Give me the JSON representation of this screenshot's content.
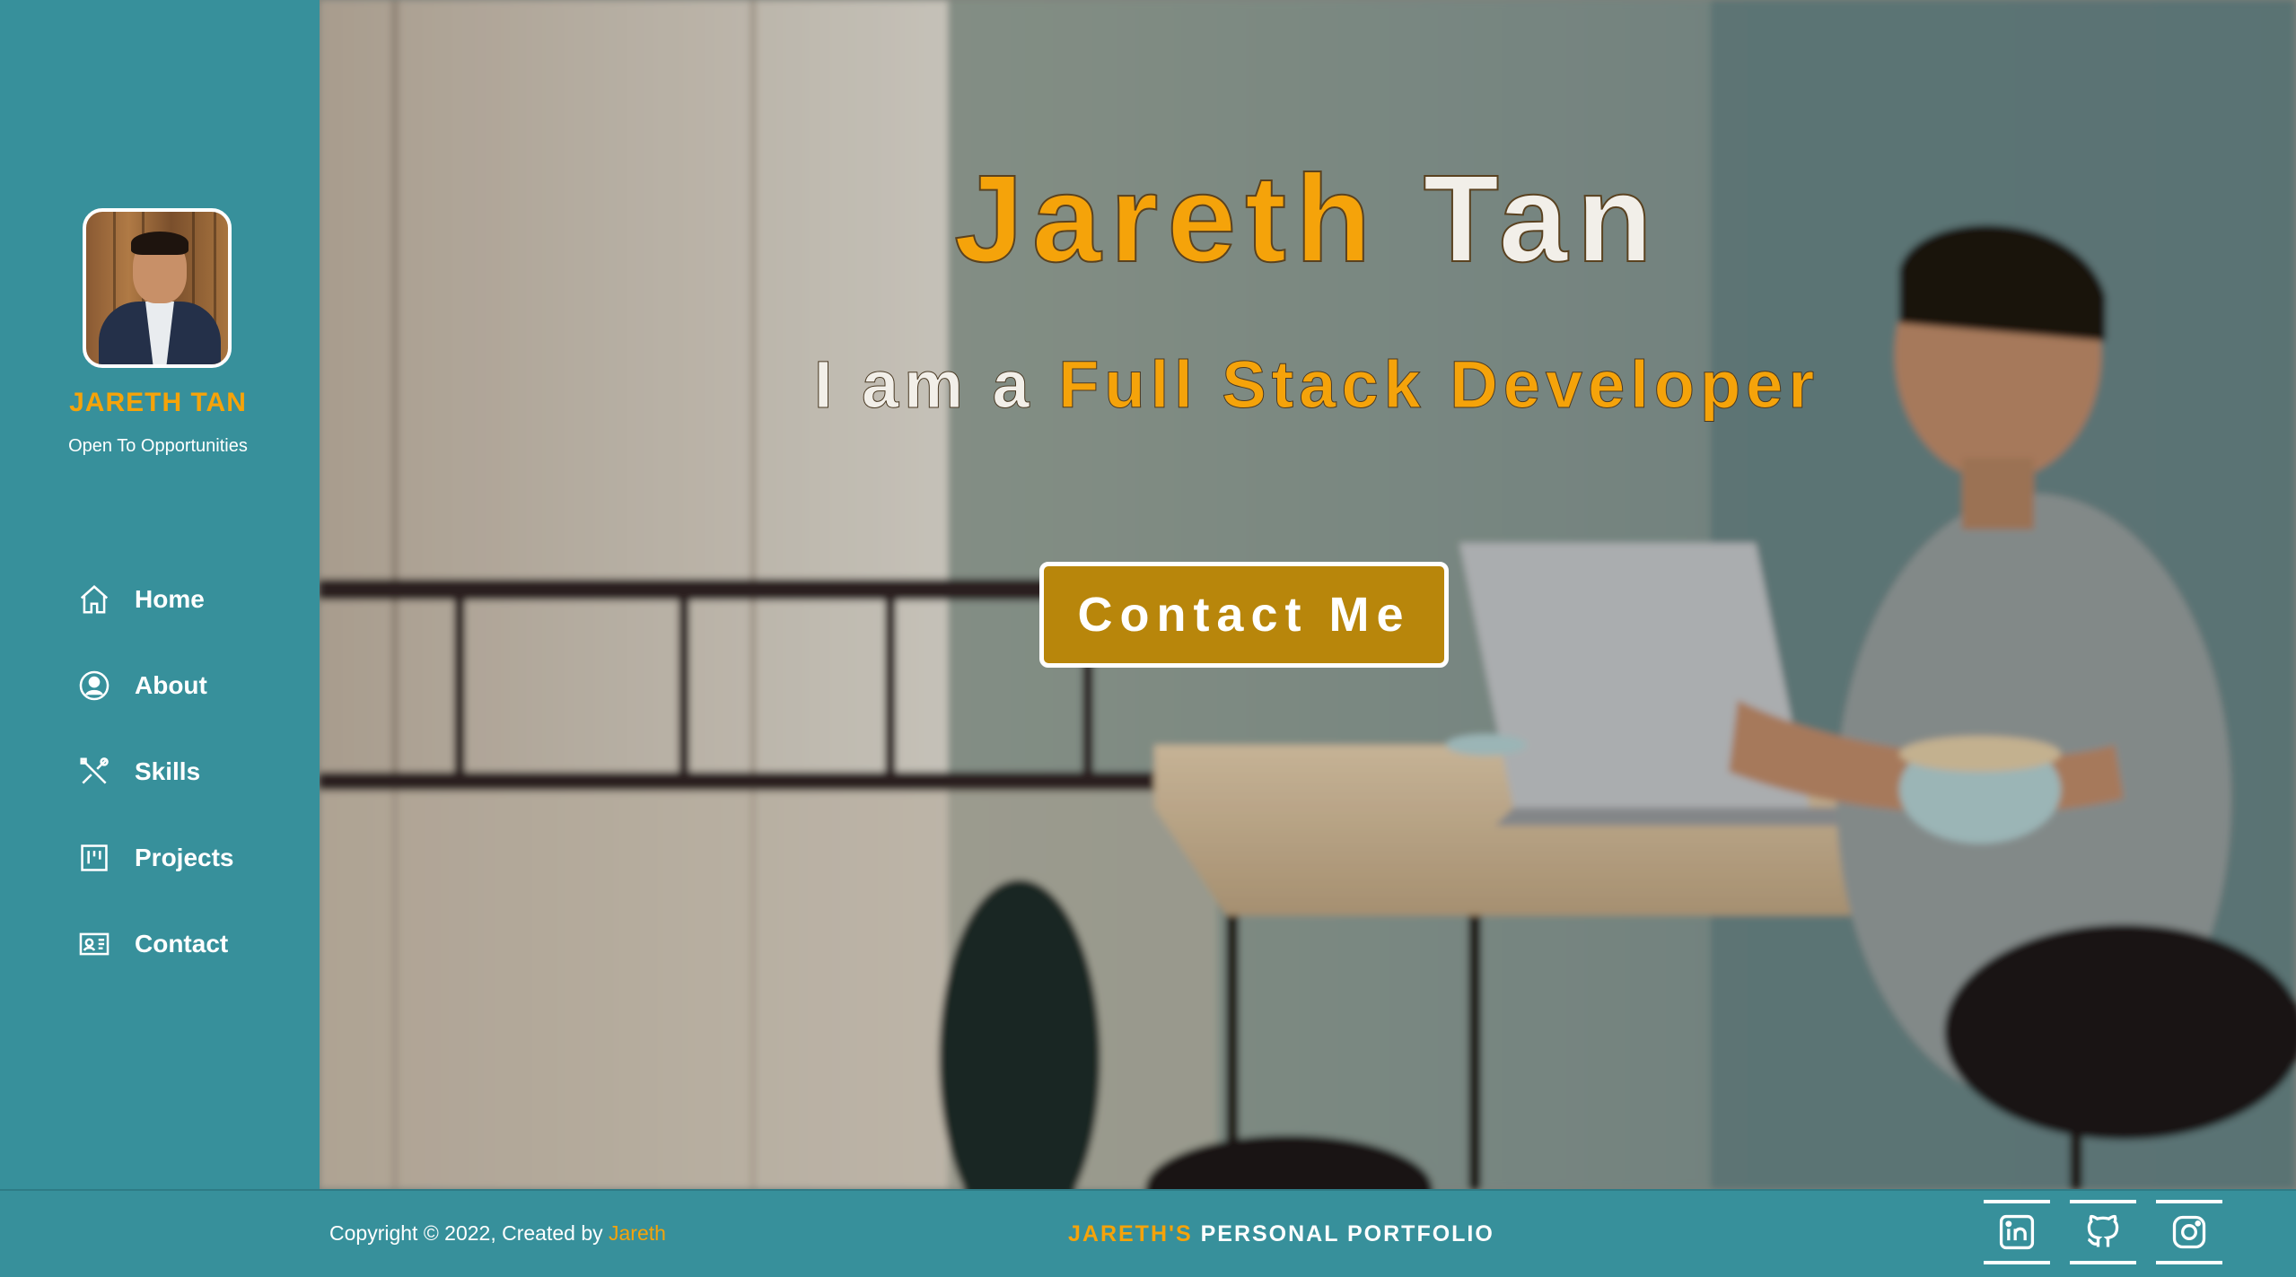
{
  "sidebar": {
    "name": "JARETH TAN",
    "status": "Open To Opportunities",
    "nav": [
      {
        "label": "Home",
        "icon": "home-icon"
      },
      {
        "label": "About",
        "icon": "user-icon"
      },
      {
        "label": "Skills",
        "icon": "tools-icon"
      },
      {
        "label": "Projects",
        "icon": "kanban-icon"
      },
      {
        "label": "Contact",
        "icon": "contact-card-icon"
      }
    ]
  },
  "hero": {
    "first_name": "Jareth",
    "last_name": "Tan",
    "subtitle_prefix": "I am a",
    "subtitle_role": "Full Stack Developer",
    "contact_button": "Contact Me"
  },
  "footer": {
    "copyright": "Copyright © 2022, Created by",
    "author": "Jareth",
    "brand_accent": "JARETH'S",
    "brand_rest": "PERSONAL PORTFOLIO",
    "social": [
      "linkedin-icon",
      "github-icon",
      "instagram-icon"
    ]
  },
  "colors": {
    "teal": "#37909b",
    "accent": "#f5a30a",
    "button": "#b8860b"
  }
}
